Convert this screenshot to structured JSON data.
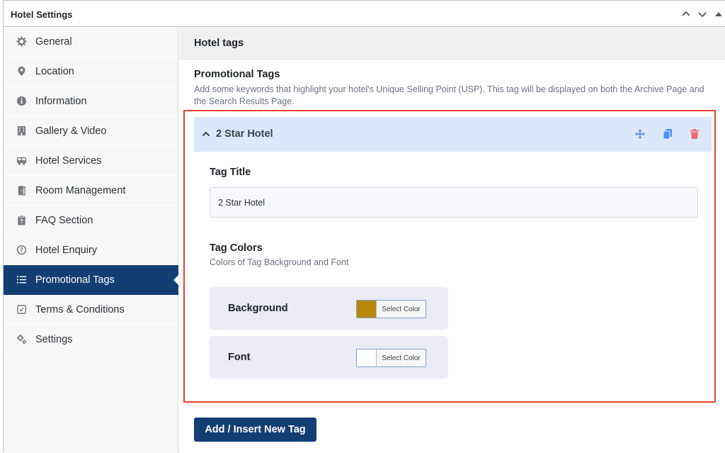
{
  "panel": {
    "title": "Hotel Settings"
  },
  "sidebar": {
    "items": [
      {
        "label": "General",
        "icon": "gear-icon"
      },
      {
        "label": "Location",
        "icon": "location-pin-icon"
      },
      {
        "label": "Information",
        "icon": "info-icon"
      },
      {
        "label": "Gallery & Video",
        "icon": "building-icon"
      },
      {
        "label": "Hotel Services",
        "icon": "bus-icon"
      },
      {
        "label": "Room Management",
        "icon": "door-icon"
      },
      {
        "label": "FAQ Section",
        "icon": "clipboard-icon"
      },
      {
        "label": "Hotel Enquiry",
        "icon": "question-circle-icon"
      },
      {
        "label": "Promotional Tags",
        "icon": "list-icon",
        "active": true
      },
      {
        "label": "Terms & Conditions",
        "icon": "checkbox-icon"
      },
      {
        "label": "Settings",
        "icon": "gears-icon"
      }
    ]
  },
  "section": {
    "title": "Hotel tags",
    "field_title": "Promotional Tags",
    "field_desc": "Add some keywords that highlight your hotel's Unique Selling Point (USP). This tag will be displayed on both the Archive Page and the Search Results Page."
  },
  "tag": {
    "name": "2 Star Hotel",
    "title_label": "Tag Title",
    "title_value": "2 Star Hotel",
    "colors_label": "Tag Colors",
    "colors_desc": "Colors of Tag Background and Font",
    "background_label": "Background",
    "background_color": "#b8860b",
    "font_label": "Font",
    "font_color": "#ffffff",
    "picker_label": "Select Color"
  },
  "add_button": "Add / Insert New Tag",
  "colors": {
    "accent": "#123e72",
    "highlight": "#e8412c",
    "move": "#4f8ff7",
    "copy": "#4f8ff7",
    "delete": "#f26b6b"
  }
}
